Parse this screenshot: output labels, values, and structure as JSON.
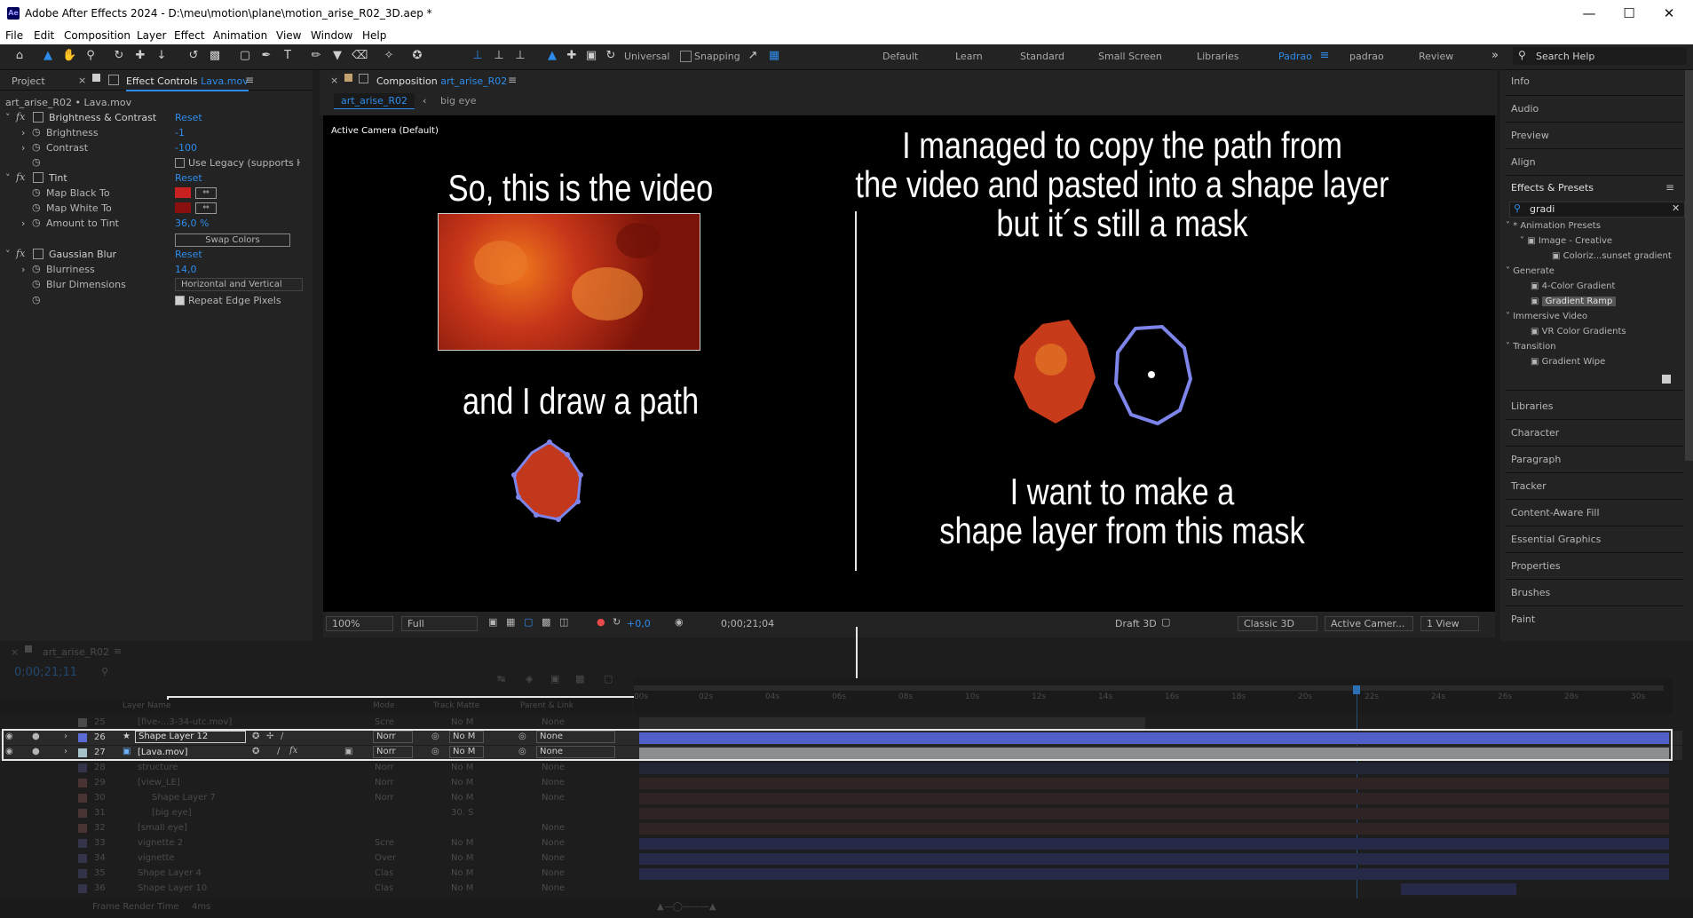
{
  "window": {
    "title": "Adobe After Effects 2024 - D:\\meu\\motion\\plane\\motion_arise_R02_3D.aep *",
    "app_icon": "Ae"
  },
  "menu": [
    "File",
    "Edit",
    "Composition",
    "Layer",
    "Effect",
    "Animation",
    "View",
    "Window",
    "Help"
  ],
  "toolbar": {
    "universal_label": "Universal",
    "snapping_label": "Snapping"
  },
  "workspaces": [
    "Default",
    "Learn",
    "Standard",
    "Small Screen",
    "Libraries",
    "Padrao",
    "padrao",
    "Review"
  ],
  "search_help": "Search Help",
  "left_panel": {
    "tab_project": "Project",
    "tab_effect_controls": "Effect Controls",
    "tab_effect_controls_file": "Lava.mov",
    "breadcrumb": "art_arise_R02 • Lava.mov",
    "effects": [
      {
        "name": "Brightness & Contrast",
        "reset": "Reset",
        "props": [
          {
            "label": "Brightness",
            "value": "-1"
          },
          {
            "label": "Contrast",
            "value": "-100"
          },
          {
            "label": "",
            "value": "Use Legacy (supports H"
          }
        ]
      },
      {
        "name": "Tint",
        "reset": "Reset",
        "props": [
          {
            "label": "Map Black To",
            "value": ""
          },
          {
            "label": "Map White To",
            "value": ""
          },
          {
            "label": "Amount to Tint",
            "value": "36,0 %"
          },
          {
            "label": "",
            "value": "Swap Colors"
          }
        ]
      },
      {
        "name": "Gaussian Blur",
        "reset": "Reset",
        "props": [
          {
            "label": "Blurriness",
            "value": "14,0"
          },
          {
            "label": "Blur Dimensions",
            "value": "Horizontal and Vertical"
          },
          {
            "label": "",
            "value": "Repeat Edge Pixels"
          }
        ]
      }
    ]
  },
  "composition": {
    "tab_label": "Composition",
    "tab_name": "art_arise_R02",
    "crumb_active": "art_arise_R02",
    "crumb_next": "big eye",
    "camera_label": "Active Camera (Default)",
    "annotations": {
      "left_top": "So, this is the video",
      "left_mid": "and I draw a path",
      "right_top_1": "I managed to copy the path from",
      "right_top_2": "the video and pasted into a shape layer",
      "right_top_3": "but it´s still a mask",
      "right_bottom_1": "I want to make a",
      "right_bottom_2": "shape layer from this mask"
    },
    "footer": {
      "zoom": "100%",
      "resolution": "Full",
      "exposure": "+0,0",
      "timecode": "0;00;21;04",
      "draft": "Draft 3D",
      "renderer": "Classic 3D",
      "camera": "Active Camer...",
      "views": "1 View"
    }
  },
  "right_panel": {
    "top_items": [
      "Info",
      "Audio",
      "Preview",
      "Align"
    ],
    "effects_presets_title": "Effects & Presets",
    "search_value": "gradi",
    "tree": [
      {
        "label": "* Animation Presets",
        "level": 0
      },
      {
        "label": "Image - Creative",
        "level": 1
      },
      {
        "label": "Coloriz...sunset gradient",
        "level": 2
      },
      {
        "label": "Generate",
        "level": 0
      },
      {
        "label": "4-Color Gradient",
        "level": 1
      },
      {
        "label": "Gradient Ramp",
        "level": 1
      },
      {
        "label": "Immersive Video",
        "level": 0
      },
      {
        "label": "VR Color Gradients",
        "level": 1
      },
      {
        "label": "Transition",
        "level": 0
      },
      {
        "label": "Gradient Wipe",
        "level": 1
      }
    ],
    "bottom_items": [
      "Libraries",
      "Character",
      "Paragraph",
      "Tracker",
      "Content-Aware Fill",
      "Essential Graphics",
      "Properties",
      "Brushes",
      "Paint"
    ]
  },
  "timeline": {
    "comp_name": "art_arise_R02",
    "timecode": "0;00;21;11",
    "columns": [
      "Layer Name",
      "Mode",
      "Track Matte",
      "Parent & Link"
    ],
    "ruler": [
      "00s",
      "02s",
      "04s",
      "06s",
      "08s",
      "10s",
      "12s",
      "14s",
      "16s",
      "18s",
      "20s",
      "22s",
      "24s",
      "26s",
      "28s",
      "30s"
    ],
    "layers": [
      {
        "num": "25",
        "name": "[five-...3-34-utc.mov]",
        "mode": "Scre",
        "matte": "No M",
        "parent": "None",
        "dim": true,
        "color": "#a7a7a7"
      },
      {
        "num": "26",
        "name": "Shape Layer 12",
        "mode": "Norr",
        "matte": "No M",
        "parent": "None",
        "dim": false,
        "color": "#5a6bd3"
      },
      {
        "num": "27",
        "name": "[Lava.mov]",
        "mode": "Norr",
        "matte": "No M",
        "parent": "None",
        "dim": false,
        "color": "#a6c3c9"
      },
      {
        "num": "28",
        "name": "structure",
        "mode": "Norr",
        "matte": "No M",
        "parent": "None",
        "dim": true,
        "color": "#6b6b9c"
      },
      {
        "num": "29",
        "name": "[view_LE]",
        "mode": "Norr",
        "matte": "No M",
        "parent": "None",
        "dim": true,
        "color": "#9c6b6b"
      },
      {
        "num": "30",
        "name": "Shape Layer 7",
        "mode": "Norr",
        "matte": "No M",
        "parent": "None",
        "dim": true,
        "color": "#9c6b6b"
      },
      {
        "num": "31",
        "name": "[big eye]",
        "mode": "",
        "matte": "30. S",
        "parent": "",
        "dim": true,
        "color": "#9c6b6b"
      },
      {
        "num": "32",
        "name": "[small eye]",
        "mode": "",
        "matte": "",
        "parent": "None",
        "dim": true,
        "color": "#9c6b6b"
      },
      {
        "num": "33",
        "name": "vignette 2",
        "mode": "Scre",
        "matte": "No M",
        "parent": "None",
        "dim": true,
        "color": "#6b6b9c"
      },
      {
        "num": "34",
        "name": "vignette",
        "mode": "Over",
        "matte": "No M",
        "parent": "None",
        "dim": true,
        "color": "#6b6b9c"
      },
      {
        "num": "35",
        "name": "Shape Layer 4",
        "mode": "Clas",
        "matte": "No M",
        "parent": "None",
        "dim": true,
        "color": "#6b6b9c"
      },
      {
        "num": "36",
        "name": "Shape Layer 10",
        "mode": "Clas",
        "matte": "No M",
        "parent": "None",
        "dim": true,
        "color": "#6b6b9c"
      }
    ],
    "footer": "Frame Render Time",
    "footer_value": "4ms"
  }
}
